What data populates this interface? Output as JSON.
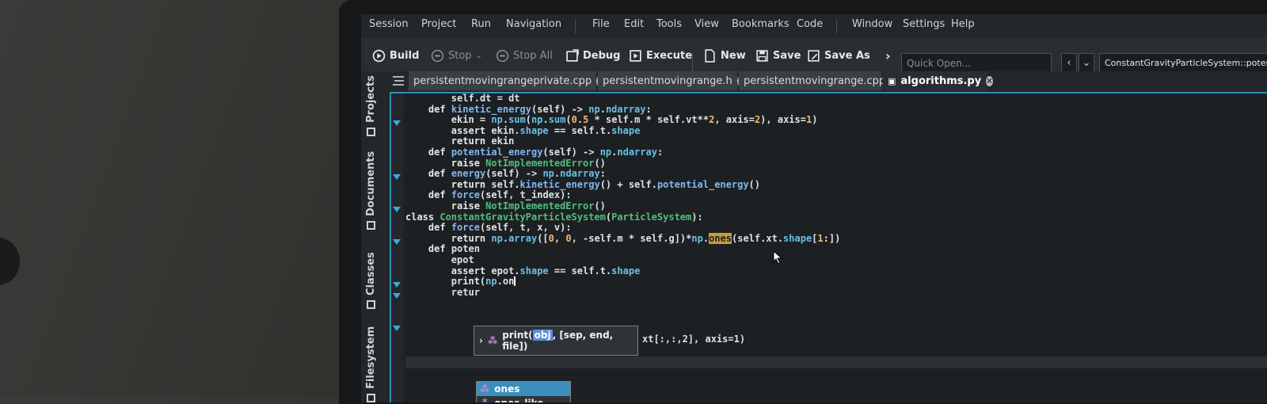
{
  "menu": [
    "Session",
    "Project",
    "Run",
    "Navigation",
    "File",
    "Edit",
    "Tools",
    "View",
    "Bookmarks",
    "Code",
    "Window",
    "Settings",
    "Help"
  ],
  "toolbar": {
    "build": "Build",
    "stop": "Stop",
    "stop_all": "Stop All",
    "debug": "Debug",
    "execute": "Execute",
    "new": "New",
    "save": "Save",
    "save_as": "Save As",
    "quick_open_placeholder": "Quick Open...",
    "breadcrumb": "ConstantGravityParticleSystem::potential_energy"
  },
  "sidebar": [
    "Projects",
    "Documents",
    "Classes",
    "Filesystem"
  ],
  "tabs": [
    {
      "label": "persistentmovingrangeprivate.cpp",
      "active": false
    },
    {
      "label": "persistentmovingrange.h",
      "active": false
    },
    {
      "label": "persistentmovingrange.cpp",
      "active": false
    },
    {
      "label": "algorithms.py",
      "active": true
    }
  ],
  "code_lines": [
    "        self.dt = dt",
    "",
    "    def kinetic_energy(self) -> np.ndarray:",
    "        ekin = np.sum(np.sum(0.5 * self.m * self.vt**2, axis=2), axis=1)",
    "        assert ekin.shape == self.t.shape",
    "        return ekin",
    "",
    "    def potential_energy(self) -> np.ndarray:",
    "        raise NotImplementedError()",
    "",
    "    def energy(self) -> np.ndarray:",
    "        return self.kinetic_energy() + self.potential_energy()",
    "",
    "    def force(self, t_index):",
    "        raise NotImplementedError()",
    "",
    "",
    "class ConstantGravityParticleSystem(ParticleSystem):",
    "    def force(self, t, x, v):",
    "        return np.array([0, 0, -self.m * self.g])*np.ones(self.xt.shape[1:])",
    "",
    "    def poten",
    "        epot",
    "        assert epot.shape == self.t.shape",
    "        print(np.on",
    "        retur"
  ],
  "signature_hint": {
    "prefix": "print",
    "highlight": "obj",
    "rest": ", [sep, end, file])"
  },
  "epot_tail": "xt[:,:,2], axis=1)",
  "completions": [
    "ones",
    "ones_like"
  ]
}
